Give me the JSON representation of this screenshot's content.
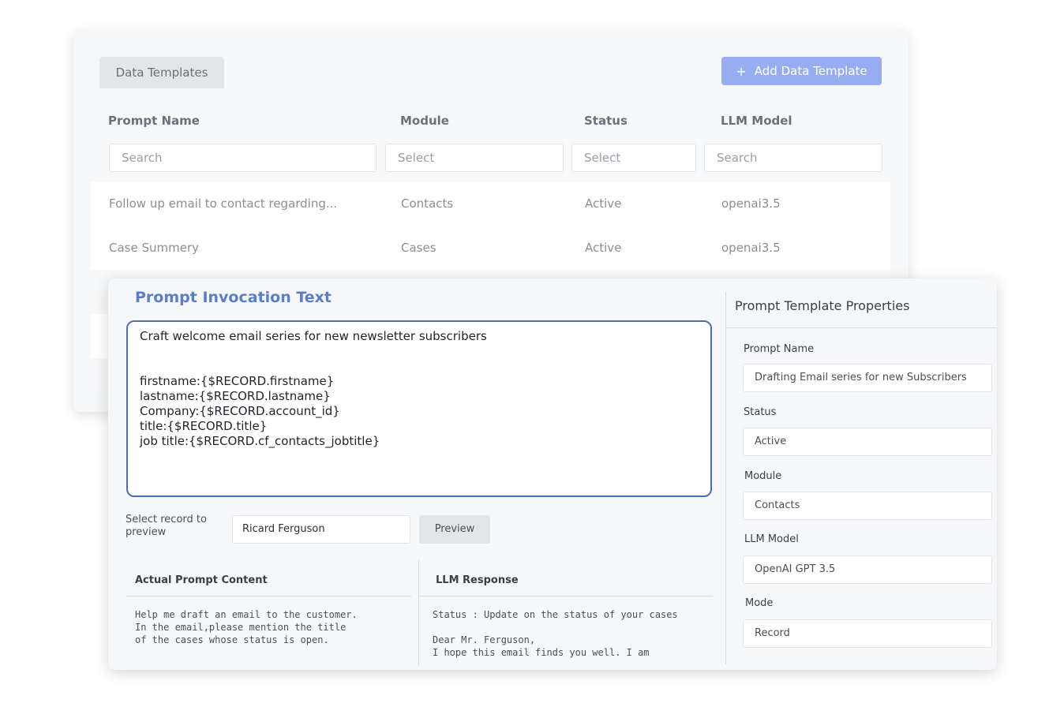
{
  "templates": {
    "tab_label": "Data Templates",
    "add_button_label": "Add Data Template",
    "add_button_icon": "+",
    "columns": [
      "Prompt Name",
      "Module",
      "Status",
      "LLM Model"
    ],
    "filters": [
      "Search",
      "Select",
      "Select",
      "Search"
    ],
    "rows": [
      [
        "Follow up email to contact regarding...",
        "Contacts",
        "Active",
        "openai3.5"
      ],
      [
        "Case Summery",
        "Cases",
        "Active",
        "openai3.5"
      ]
    ]
  },
  "editor": {
    "title": "Prompt Invocation Text",
    "prompt_lines": [
      "Craft welcome email series for new newsletter subscribers",
      "firstname:{$RECORD.firstname}",
      "lastname:{$RECORD.lastname}",
      "Company:{$RECORD.account_id}",
      "title:{$RECORD.title}",
      "job title:{$RECORD.cf_contacts_jobtitle}"
    ],
    "select_record_label": "Select record to preview",
    "record_value": "Ricard Ferguson",
    "preview_label": "Preview",
    "actual_prompt_heading": "Actual Prompt Content",
    "actual_prompt_text": "Help me draft an email to the customer.\nIn the email,please mention the title\nof the cases whose status is open.",
    "llm_response_heading": "LLM Response",
    "llm_response_text": "Status : Update on the status of your cases\n\nDear Mr. Ferguson,\nI hope this email finds you well. I am"
  },
  "properties": {
    "title": "Prompt Template Properties",
    "fields": [
      {
        "label": "Prompt Name",
        "value": "Drafting Email series for new Subscribers"
      },
      {
        "label": "Status",
        "value": "Active"
      },
      {
        "label": "Module",
        "value": "Contacts"
      },
      {
        "label": "LLM Model",
        "value": "OpenAI GPT 3.5"
      },
      {
        "label": "Mode",
        "value": "Record"
      }
    ]
  },
  "colors": {
    "accent_button": "#98acf2",
    "title_blue": "#5a7fc9",
    "prompt_border": "#4e6eb3"
  }
}
